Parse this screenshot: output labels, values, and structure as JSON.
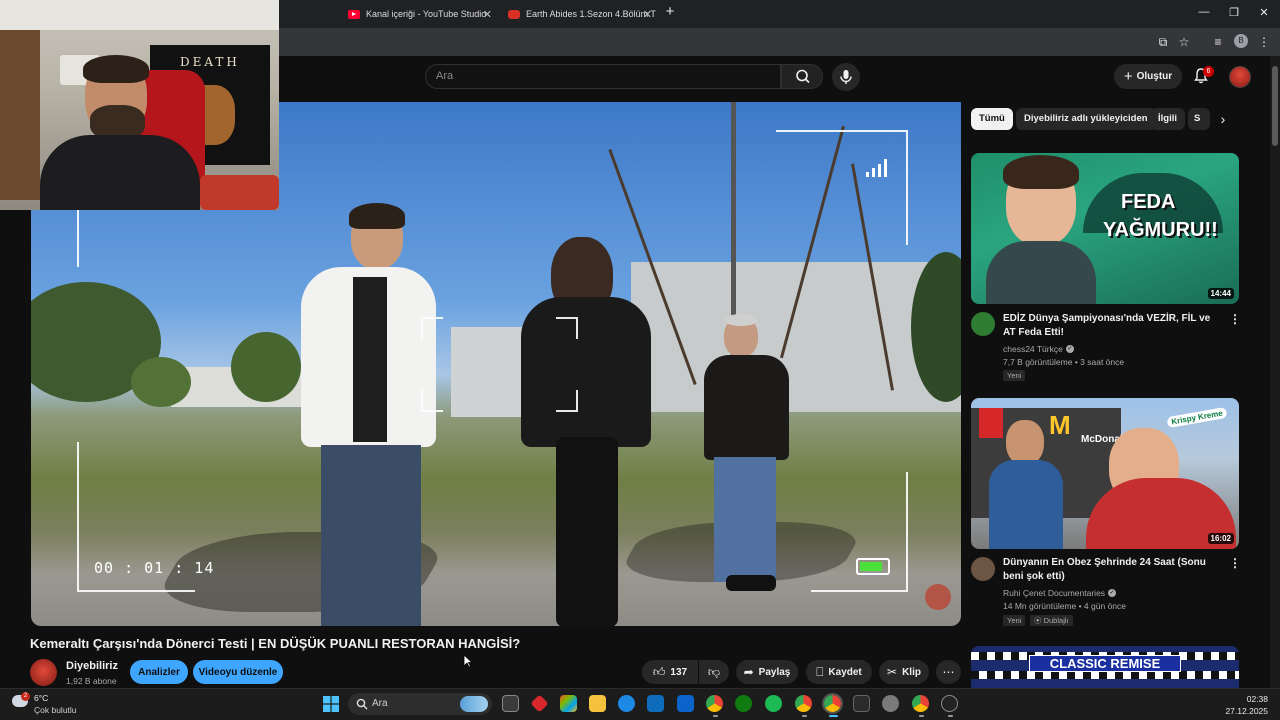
{
  "browser": {
    "tabs": [
      {
        "title": "Kanal içeriği - YouTube Studio"
      },
      {
        "title": "Earth Abides 1.Sezon 4.Bölüm T"
      }
    ],
    "new_tab_label": "+",
    "profile_initial": "B"
  },
  "yt_header": {
    "search_placeholder": "Ara",
    "create_label": "Oluştur",
    "notification_count": "6"
  },
  "player": {
    "timecode": "00 : 01 : 14",
    "webcam_poster_text": "DEATH"
  },
  "video": {
    "title": "Kemeraltı Çarşısı'nda Dönerci Testi | EN DÜŞÜK PUANLI RESTORAN HANGİSİ?",
    "channel_name": "Diyebiliriz",
    "subscribers": "1,92 B abone",
    "analytics_label": "Analizler",
    "edit_label": "Videoyu düzenle",
    "like_count": "137",
    "share_label": "Paylaş",
    "save_label": "Kaydet",
    "clip_label": "Klip"
  },
  "sidebar": {
    "chips": [
      {
        "label": "Tümü",
        "active": true
      },
      {
        "label": "Diyebiliriz adlı yükleyiciden",
        "active": false
      },
      {
        "label": "İlgili",
        "active": false
      },
      {
        "label": "S",
        "active": false
      }
    ],
    "recommendations": [
      {
        "thumb_text_1": "FEDA",
        "thumb_text_2": "YAĞMURU!!",
        "duration": "14:44",
        "title": "EDİZ Dünya Şampiyonası'nda VEZİR, FİL ve AT Feda Etti!",
        "channel": "chess24 Türkçe",
        "meta": "7,7 B görüntüleme • 3 saat önce",
        "badge": "Yeni"
      },
      {
        "thumb_text_1": "McDonald's",
        "thumb_text_2": "Krispy Kreme",
        "duration": "16:02",
        "title": "Dünyanın En Obez Şehrinde 24 Saat (Sonu beni şok etti)",
        "channel": "Ruhi Çenet Documentaries",
        "meta": "14 Mn görüntüleme • 4 gün önce",
        "badge": "Yeni",
        "badge2": "Dublajlı"
      },
      {
        "thumb_text_1": "CLASSIC REMISE"
      }
    ]
  },
  "taskbar": {
    "weather_temp": "6°C",
    "weather_desc": "Çok bulutlu",
    "weather_badge": "2",
    "search_placeholder": "Ara",
    "time": "02:38",
    "date": "27.12.2025"
  },
  "colors": {
    "background": "#0f0f0f",
    "accent_blue": "#3ea6ff",
    "youtube_red": "#ff0033",
    "battery_green": "#4ce13a"
  }
}
